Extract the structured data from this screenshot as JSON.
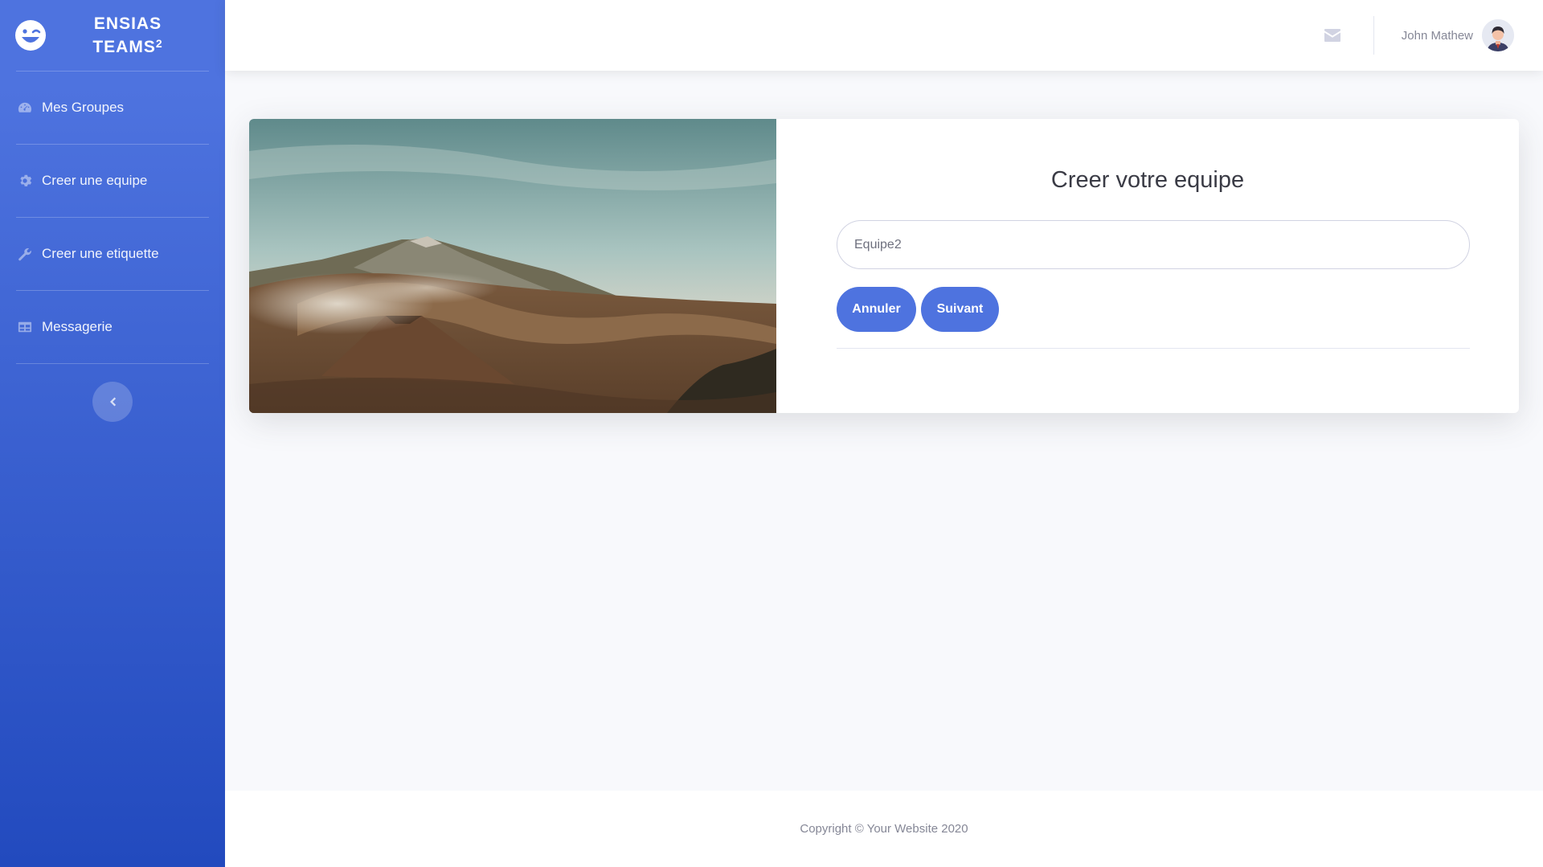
{
  "brand": {
    "line1": "ENSIAS",
    "line2": "TEAMS",
    "sup": "2",
    "logo_icon": "laugh-wink-icon"
  },
  "sidebar": {
    "items": [
      {
        "label": "Mes Groupes",
        "icon": "tachometer-icon"
      },
      {
        "label": "Creer une equipe",
        "icon": "cog-icon"
      },
      {
        "label": "Creer une etiquette",
        "icon": "wrench-icon"
      },
      {
        "label": "Messagerie",
        "icon": "table-icon"
      }
    ],
    "toggle_icon": "chevron-left-icon"
  },
  "topbar": {
    "mail_icon": "envelope-icon",
    "user_name": "John Mathew"
  },
  "form": {
    "title": "Creer votre equipe",
    "team_name_value": "Equipe2",
    "cancel_label": "Annuler",
    "next_label": "Suivant"
  },
  "footer": {
    "copyright": "Copyright © Your Website 2020"
  },
  "colors": {
    "primary": "#4e73df",
    "primary_dark": "#224abe",
    "background": "#f8f9fc"
  }
}
